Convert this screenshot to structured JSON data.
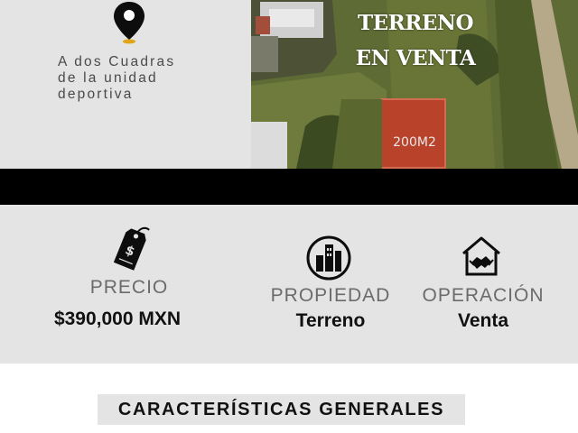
{
  "location": {
    "line1": "A dos Cuadras",
    "line2": "de la unidad",
    "line3": "deportiva"
  },
  "banner": {
    "title_line1": "TERRENO",
    "title_line2": "EN VENTA",
    "lot_size": "200M2"
  },
  "info": {
    "price": {
      "label": "PRECIO",
      "value": "$390,000 MXN",
      "icon": "price-tag-icon"
    },
    "property": {
      "label": "PROPIEDAD",
      "value": "Terreno",
      "icon": "buildings-icon"
    },
    "operation": {
      "label": "OPERACIÓN",
      "value": "Venta",
      "icon": "handshake-house-icon"
    }
  },
  "characteristics": {
    "title": "CARACTERÍSTICAS GENERALES"
  },
  "colors": {
    "panel": "#e4e4e4",
    "band": "#000000",
    "lot": "#b8422a",
    "pin_dot": "#e0a416"
  }
}
